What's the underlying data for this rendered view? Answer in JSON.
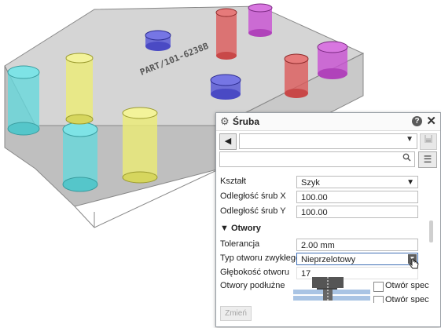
{
  "scene": {
    "part_label": "PART/101-6238B",
    "colors": {
      "block": "#b9b9b9",
      "cyan": "#66d8dc",
      "yellow": "#ecec74",
      "blue": "#5a5ad6",
      "red": "#dc5a5a",
      "magenta": "#c850d2"
    }
  },
  "panel": {
    "title": "Śruba",
    "icons": {
      "gear": "gear-icon",
      "help": "help-icon",
      "close": "close-icon",
      "back": "back-arrow-icon",
      "save": "save-icon",
      "search": "search-icon",
      "menu": "menu-icon"
    },
    "help_label": "?",
    "close_label": "✕",
    "back_label": "◀",
    "combo_value": "",
    "search_value": "",
    "fields": {
      "ksztalt_label": "Kształt",
      "ksztalt_value": "Szyk",
      "odl_x_label": "Odległość śrub X",
      "odl_x_value": "100.00",
      "odl_y_label": "Odległość śrub Y",
      "odl_y_value": "100.00"
    },
    "otwory": {
      "section_label": "▼ Otwory",
      "tolerancja_label": "Tolerancja",
      "tolerancja_value": "2.00 mm",
      "typ_label": "Typ otworu zwykłego",
      "typ_value": "Nieprzelotowy",
      "glebokosc_label": "Głębokość otworu",
      "glebokosc_value": "17",
      "podluzne_label": "Otwory podłużne",
      "checkbox1_label": "Otwór spec",
      "checkbox2_label": "Otwór spec"
    },
    "zmien_label": "Zmień"
  }
}
